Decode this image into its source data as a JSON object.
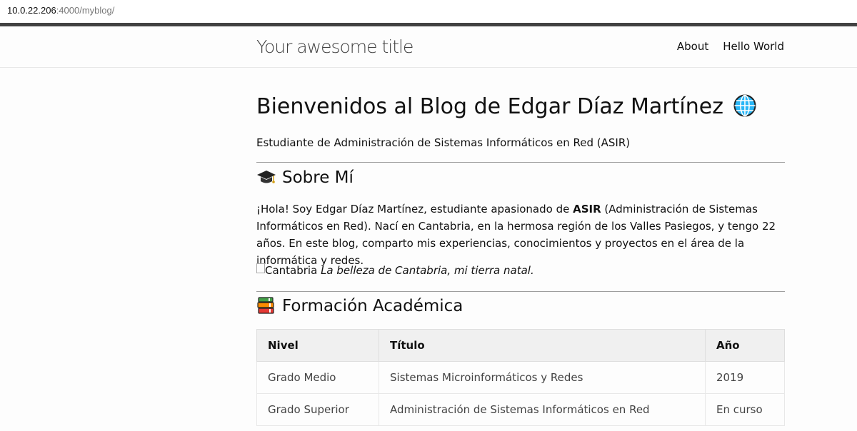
{
  "browser": {
    "url_host": "10.0.22.206",
    "url_rest": ":4000/myblog/"
  },
  "header": {
    "site_title": "Your awesome title",
    "nav": [
      {
        "label": "About"
      },
      {
        "label": "Hello World"
      }
    ]
  },
  "post": {
    "title": "Bienvenidos al Blog de Edgar Díaz Martínez",
    "title_icon": "globe-icon",
    "subtitle": "Estudiante de Administración de Sistemas Informáticos en Red (ASIR)",
    "about": {
      "heading": "Sobre Mí",
      "icon": "graduation-cap-icon",
      "intro_before": "¡Hola! Soy Edgar Díaz Martínez, estudiante apasionado de ",
      "intro_bold": "ASIR",
      "intro_after": " (Administración de Sistemas Informáticos en Red). Nací en Cantabria, en la hermosa región de los Valles Pasiegos, y tengo 22 años. En este blog, comparto mis experiencias, conocimientos y proyectos en el área de la informática y redes.",
      "image_alt": "Cantabria",
      "image_caption": "La belleza de Cantabria, mi tierra natal."
    },
    "education": {
      "heading": "Formación Académica",
      "icon": "books-icon",
      "columns": [
        "Nivel",
        "Título",
        "Año"
      ],
      "rows": [
        [
          "Grado Medio",
          "Sistemas Microinformáticos y Redes",
          "2019"
        ],
        [
          "Grado Superior",
          "Administración de Sistemas Informáticos en Red",
          "En curso"
        ]
      ]
    }
  },
  "colors": {
    "topbar": "#424242",
    "site_title": "#424242",
    "rule": "#9e9e9e",
    "table_header_bg": "#f0f0f0"
  }
}
